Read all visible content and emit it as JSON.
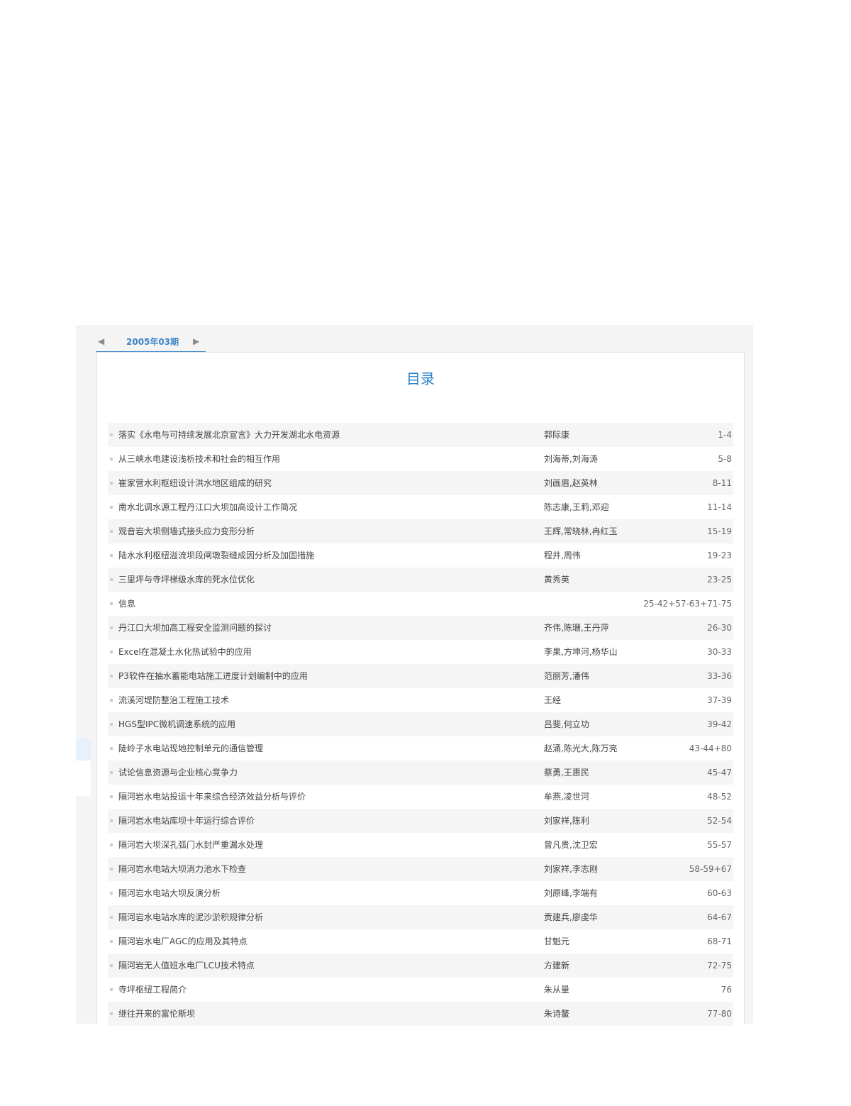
{
  "issue_nav": {
    "prev_icon": "triangle-left-icon",
    "label": "2005年03期",
    "next_icon": "triangle-right-icon"
  },
  "toc": {
    "title": "目录",
    "articles": [
      {
        "title": "落实《水电与可持续发展北京宣言》大力开发湖北水电资源",
        "authors": "郭际康",
        "pages": "1-4"
      },
      {
        "title": "从三峡水电建设浅析技术和社会的相互作用",
        "authors": "刘海蒂,刘海涛",
        "pages": "5-8"
      },
      {
        "title": "崔家营水利枢纽设计洪水地区组成的研究",
        "authors": "刘画眉,赵英林",
        "pages": "8-11"
      },
      {
        "title": "南水北调水源工程丹江口大坝加高设计工作简况",
        "authors": "陈志康,王莉,邓迎",
        "pages": "11-14"
      },
      {
        "title": "观音岩大坝侧墙式接头应力变形分析",
        "authors": "王辉,常晓林,冉红玉",
        "pages": "15-19"
      },
      {
        "title": "陆水水利枢纽溢流坝段闸墩裂缝成因分析及加固措施",
        "authors": "程井,周伟",
        "pages": "19-23"
      },
      {
        "title": "三里坪与寺坪梯级水库的死水位优化",
        "authors": "黄秀英",
        "pages": "23-25"
      },
      {
        "title": "信息",
        "authors": "",
        "pages": "25-42+57-63+71-75"
      },
      {
        "title": "丹江口大坝加高工程安全监测问题的探讨",
        "authors": "齐伟,陈珊,王丹萍",
        "pages": "26-30"
      },
      {
        "title": "Excel在混凝土水化热试验中的应用",
        "authors": "李果,方坤河,杨华山",
        "pages": "30-33"
      },
      {
        "title": "P3软件在抽水蓄能电站施工进度计划编制中的应用",
        "authors": "范丽芳,潘伟",
        "pages": "33-36"
      },
      {
        "title": "流溪河堤防整治工程施工技术",
        "authors": "王经",
        "pages": "37-39"
      },
      {
        "title": "HGS型IPC微机调速系统的应用",
        "authors": "吕斐,何立功",
        "pages": "39-42"
      },
      {
        "title": "陡岭子水电站现地控制单元的通信管理",
        "authors": "赵涌,陈光大,陈万亮",
        "pages": "43-44+80"
      },
      {
        "title": "试论信息资源与企业核心竞争力",
        "authors": "蔡勇,王惠民",
        "pages": "45-47"
      },
      {
        "title": "隔河岩水电站投运十年来综合经济效益分析与评价",
        "authors": "牟燕,凌世河",
        "pages": "48-52"
      },
      {
        "title": "隔河岩水电站库坝十年运行综合评价",
        "authors": "刘家祥,陈利",
        "pages": "52-54"
      },
      {
        "title": "隔河岩大坝深孔弧门水封严重漏水处理",
        "authors": "曾凡贵,沈卫宏",
        "pages": "55-57"
      },
      {
        "title": "隔河岩水电站大坝消力池水下检查",
        "authors": "刘家祥,李志刚",
        "pages": "58-59+67"
      },
      {
        "title": "隔河岩水电站大坝反演分析",
        "authors": "刘原峰,李端有",
        "pages": "60-63"
      },
      {
        "title": "隔河岩水电站水库的泥沙淤积规律分析",
        "authors": "贡建兵,廖虔华",
        "pages": "64-67"
      },
      {
        "title": "隔河岩水电厂AGC的应用及其特点",
        "authors": "甘魁元",
        "pages": "68-71"
      },
      {
        "title": "隔河岩无人值班水电厂LCU技术特点",
        "authors": "方建新",
        "pages": "72-75"
      },
      {
        "title": "寺坪枢纽工程简介",
        "authors": "朱从量",
        "pages": "76"
      },
      {
        "title": "继往开来的富伦斯坝",
        "authors": "朱诗鳌",
        "pages": "77-80"
      }
    ]
  }
}
